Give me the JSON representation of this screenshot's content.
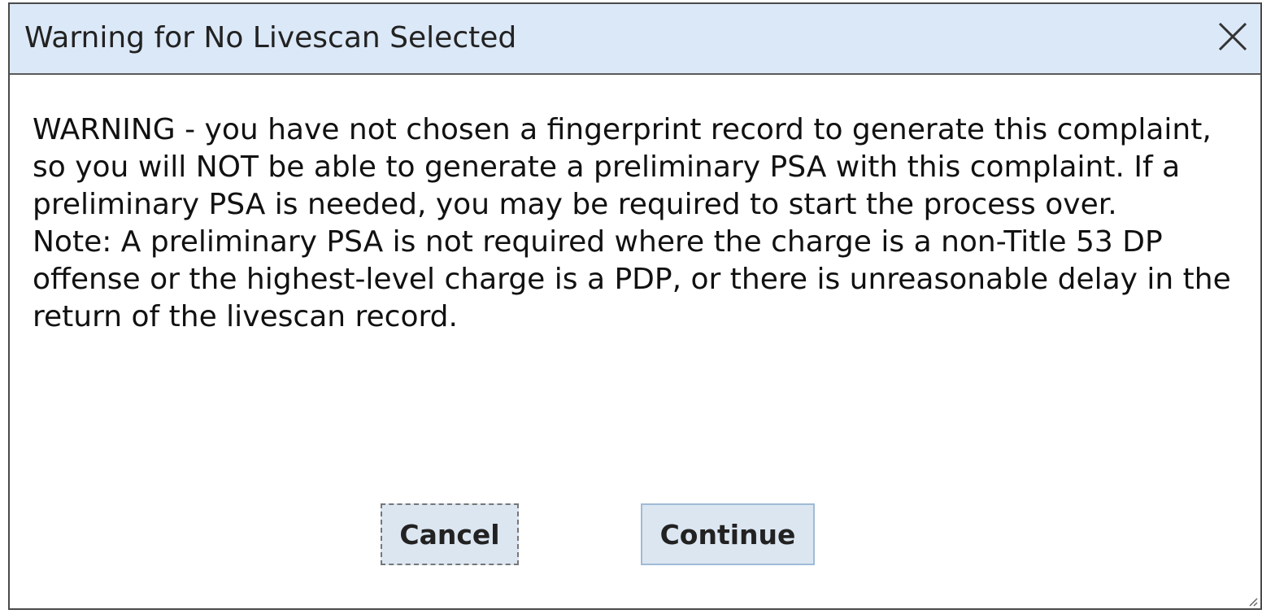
{
  "dialog": {
    "title": "Warning for No Livescan Selected",
    "close_icon": "close-icon",
    "message_paragraph_1": "WARNING - you have not chosen a fingerprint record to generate this complaint, so you will NOT be able to generate a preliminary PSA with this complaint. If a preliminary PSA is needed, you may be required to start the process over.",
    "message_paragraph_2": "Note: A preliminary PSA is not required where the charge is a non-Title 53 DP offense or the highest-level charge is a PDP, or there is unreasonable delay in the return of the livescan record.",
    "buttons": {
      "cancel_label": "Cancel",
      "continue_label": "Continue"
    },
    "resize_icon": "resize-grip-icon"
  },
  "colors": {
    "titlebar_bg": "#dbe8f7",
    "button_bg": "#dbe6f1",
    "border": "#4a4a4a"
  }
}
